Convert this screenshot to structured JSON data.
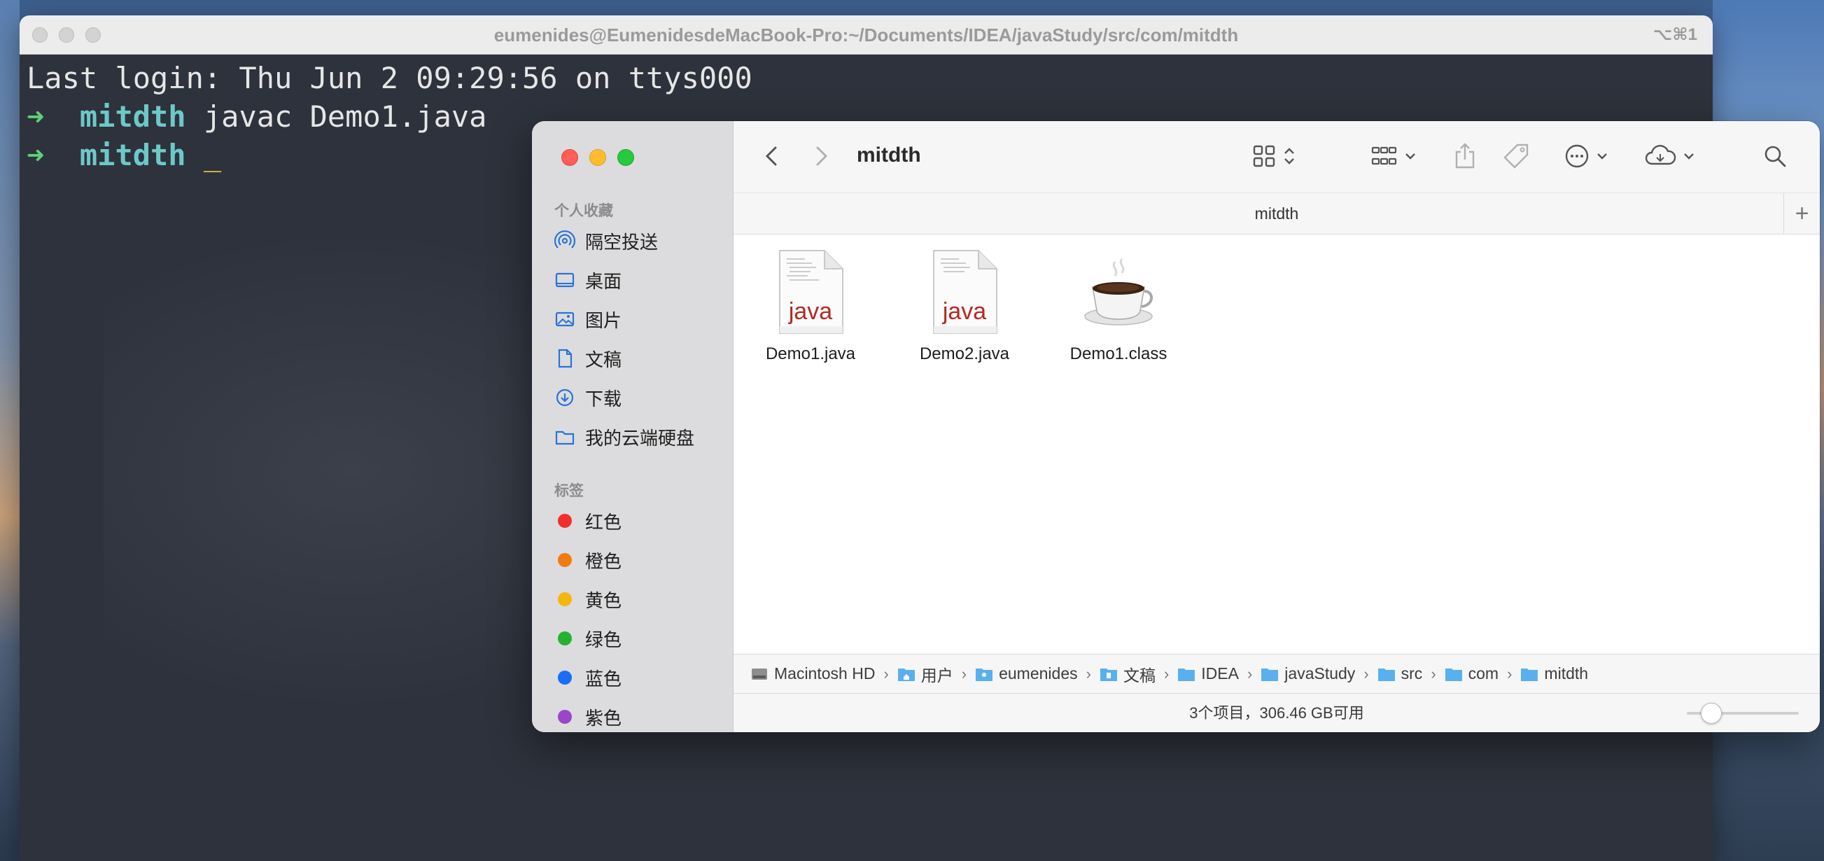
{
  "terminal": {
    "title": "eumenides@EumenidesdeMacBook-Pro:~/Documents/IDEA/javaStudy/src/com/mitdth",
    "shortcut": "⌥⌘1",
    "lines": {
      "login": "Last login: Thu Jun  2 09:29:56 on ttys000",
      "prompt_arrow": "➜",
      "dir": "mitdth",
      "cmd1": "javac Demo1.java",
      "cursor": "_"
    }
  },
  "finder": {
    "window_title": "mitdth",
    "path_title": "mitdth",
    "sidebar": {
      "favorites_title": "个人收藏",
      "favorites": [
        {
          "label": "隔空投送",
          "icon": "airdrop-icon"
        },
        {
          "label": "桌面",
          "icon": "desktop-icon"
        },
        {
          "label": "图片",
          "icon": "pictures-icon"
        },
        {
          "label": "文稿",
          "icon": "documents-icon"
        },
        {
          "label": "下载",
          "icon": "downloads-icon"
        },
        {
          "label": "我的云端硬盘",
          "icon": "folder-icon"
        }
      ],
      "tags_title": "标签",
      "tags": [
        {
          "label": "红色",
          "color": "#f0302c"
        },
        {
          "label": "橙色",
          "color": "#f07c0f"
        },
        {
          "label": "黄色",
          "color": "#f4b711"
        },
        {
          "label": "绿色",
          "color": "#25b231"
        },
        {
          "label": "蓝色",
          "color": "#1a6ef5"
        },
        {
          "label": "紫色",
          "color": "#9b46c9"
        }
      ]
    },
    "files": [
      {
        "name": "Demo1.java",
        "badge": "java",
        "type": "java-file-icon"
      },
      {
        "name": "Demo2.java",
        "badge": "java",
        "type": "java-file-icon"
      },
      {
        "name": "Demo1.class",
        "type": "coffee-cup-icon"
      }
    ],
    "breadcrumb": [
      "Macintosh HD",
      "用户",
      "eumenides",
      "文稿",
      "IDEA",
      "javaStudy",
      "src",
      "com",
      "mitdth"
    ],
    "status": "3个项目，306.46 GB可用",
    "zoom_level": 0.15,
    "plus": "+"
  }
}
